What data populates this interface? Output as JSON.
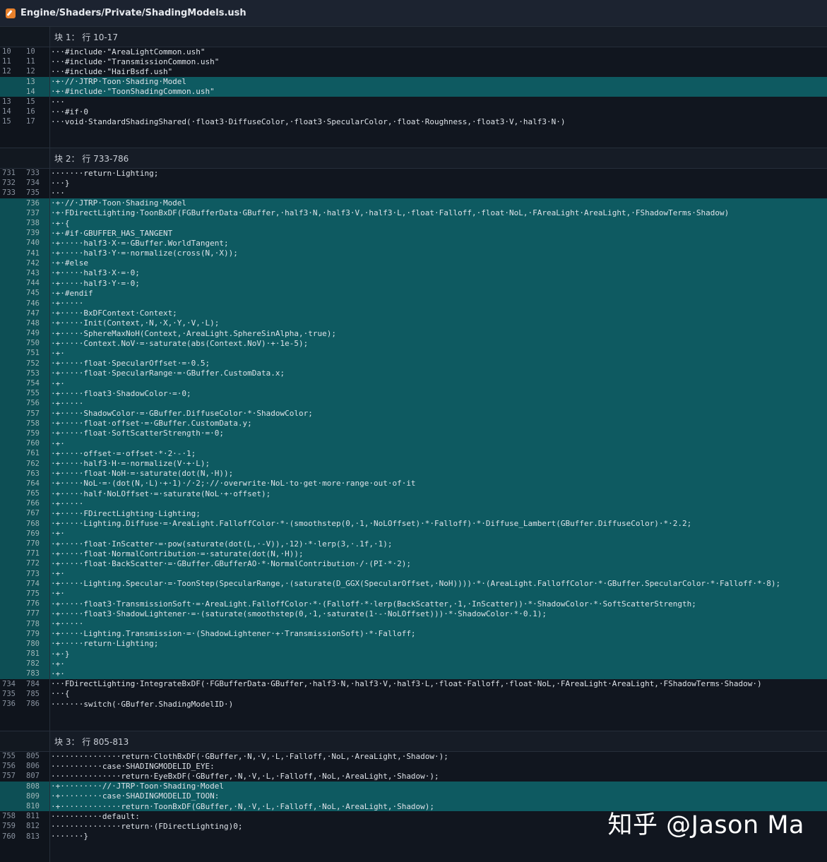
{
  "file": {
    "path": "Engine/Shaders/Private/ShadingModels.ush",
    "icon": "pencil-file-icon"
  },
  "hunks": [
    {
      "label": "块 1： 行 10-17",
      "lines": [
        {
          "o": "10",
          "n": "10",
          "t": "ctx",
          "c": "···#include·\"AreaLightCommon.ush\""
        },
        {
          "o": "11",
          "n": "11",
          "t": "ctx",
          "c": "···#include·\"TransmissionCommon.ush\""
        },
        {
          "o": "12",
          "n": "12",
          "t": "ctx",
          "c": "···#include·\"HairBsdf.ush\""
        },
        {
          "o": "",
          "n": "13",
          "t": "add",
          "c": "·+·//·JTRP·Toon·Shading·Model"
        },
        {
          "o": "",
          "n": "14",
          "t": "add",
          "c": "·+·#include·\"ToonShadingCommon.ush\""
        },
        {
          "o": "13",
          "n": "15",
          "t": "ctx",
          "c": "···"
        },
        {
          "o": "14",
          "n": "16",
          "t": "ctx",
          "c": "···#if·0"
        },
        {
          "o": "15",
          "n": "17",
          "t": "ctx",
          "c": "···void·StandardShadingShared(·float3·DiffuseColor,·float3·SpecularColor,·float·Roughness,·float3·V,·half3·N·)"
        }
      ]
    },
    {
      "label": "块 2： 行 733-786",
      "lines": [
        {
          "o": "731",
          "n": "733",
          "t": "ctx",
          "c": "·······return·Lighting;"
        },
        {
          "o": "732",
          "n": "734",
          "t": "ctx",
          "c": "···}"
        },
        {
          "o": "733",
          "n": "735",
          "t": "ctx",
          "c": "···"
        },
        {
          "o": "",
          "n": "736",
          "t": "add",
          "c": "·+·//·JTRP·Toon·Shading·Model"
        },
        {
          "o": "",
          "n": "737",
          "t": "add",
          "c": "·+·FDirectLighting·ToonBxDF(FGBufferData·GBuffer,·half3·N,·half3·V,·half3·L,·float·Falloff,·float·NoL,·FAreaLight·AreaLight,·FShadowTerms·Shadow)"
        },
        {
          "o": "",
          "n": "738",
          "t": "add",
          "c": "·+·{"
        },
        {
          "o": "",
          "n": "739",
          "t": "add",
          "c": "·+·#if·GBUFFER_HAS_TANGENT"
        },
        {
          "o": "",
          "n": "740",
          "t": "add",
          "c": "·+·····half3·X·=·GBuffer.WorldTangent;"
        },
        {
          "o": "",
          "n": "741",
          "t": "add",
          "c": "·+·····half3·Y·=·normalize(cross(N,·X));"
        },
        {
          "o": "",
          "n": "742",
          "t": "add",
          "c": "·+·#else"
        },
        {
          "o": "",
          "n": "743",
          "t": "add",
          "c": "·+·····half3·X·=·0;"
        },
        {
          "o": "",
          "n": "744",
          "t": "add",
          "c": "·+·····half3·Y·=·0;"
        },
        {
          "o": "",
          "n": "745",
          "t": "add",
          "c": "·+·#endif"
        },
        {
          "o": "",
          "n": "746",
          "t": "add",
          "c": "·+·····"
        },
        {
          "o": "",
          "n": "747",
          "t": "add",
          "c": "·+·····BxDFContext·Context;"
        },
        {
          "o": "",
          "n": "748",
          "t": "add",
          "c": "·+·····Init(Context,·N,·X,·Y,·V,·L);"
        },
        {
          "o": "",
          "n": "749",
          "t": "add",
          "c": "·+·····SphereMaxNoH(Context,·AreaLight.SphereSinAlpha,·true);"
        },
        {
          "o": "",
          "n": "750",
          "t": "add",
          "c": "·+·····Context.NoV·=·saturate(abs(Context.NoV)·+·1e-5);"
        },
        {
          "o": "",
          "n": "751",
          "t": "add",
          "c": "·+·"
        },
        {
          "o": "",
          "n": "752",
          "t": "add",
          "c": "·+·····float·SpecularOffset·=·0.5;"
        },
        {
          "o": "",
          "n": "753",
          "t": "add",
          "c": "·+·····float·SpecularRange·=·GBuffer.CustomData.x;"
        },
        {
          "o": "",
          "n": "754",
          "t": "add",
          "c": "·+·"
        },
        {
          "o": "",
          "n": "755",
          "t": "add",
          "c": "·+·····float3·ShadowColor·=·0;"
        },
        {
          "o": "",
          "n": "756",
          "t": "add",
          "c": "·+·····"
        },
        {
          "o": "",
          "n": "757",
          "t": "add",
          "c": "·+·····ShadowColor·=·GBuffer.DiffuseColor·*·ShadowColor;"
        },
        {
          "o": "",
          "n": "758",
          "t": "add",
          "c": "·+·····float·offset·=·GBuffer.CustomData.y;"
        },
        {
          "o": "",
          "n": "759",
          "t": "add",
          "c": "·+·····float·SoftScatterStrength·=·0;"
        },
        {
          "o": "",
          "n": "760",
          "t": "add",
          "c": "·+·"
        },
        {
          "o": "",
          "n": "761",
          "t": "add",
          "c": "·+·····offset·=·offset·*·2·-·1;"
        },
        {
          "o": "",
          "n": "762",
          "t": "add",
          "c": "·+·····half3·H·=·normalize(V·+·L);"
        },
        {
          "o": "",
          "n": "763",
          "t": "add",
          "c": "·+·····float·NoH·=·saturate(dot(N,·H));"
        },
        {
          "o": "",
          "n": "764",
          "t": "add",
          "c": "·+·····NoL·=·(dot(N,·L)·+·1)·/·2;·//·overwrite·NoL·to·get·more·range·out·of·it"
        },
        {
          "o": "",
          "n": "765",
          "t": "add",
          "c": "·+·····half·NoLOffset·=·saturate(NoL·+·offset);"
        },
        {
          "o": "",
          "n": "766",
          "t": "add",
          "c": "·+·····"
        },
        {
          "o": "",
          "n": "767",
          "t": "add",
          "c": "·+·····FDirectLighting·Lighting;"
        },
        {
          "o": "",
          "n": "768",
          "t": "add",
          "c": "·+·····Lighting.Diffuse·=·AreaLight.FalloffColor·*·(smoothstep(0,·1,·NoLOffset)·*·Falloff)·*·Diffuse_Lambert(GBuffer.DiffuseColor)·*·2.2;"
        },
        {
          "o": "",
          "n": "769",
          "t": "add",
          "c": "·+·"
        },
        {
          "o": "",
          "n": "770",
          "t": "add",
          "c": "·+·····float·InScatter·=·pow(saturate(dot(L,·-V)),·12)·*·lerp(3,·.1f,·1);"
        },
        {
          "o": "",
          "n": "771",
          "t": "add",
          "c": "·+·····float·NormalContribution·=·saturate(dot(N,·H));"
        },
        {
          "o": "",
          "n": "772",
          "t": "add",
          "c": "·+·····float·BackScatter·=·GBuffer.GBufferAO·*·NormalContribution·/·(PI·*·2);"
        },
        {
          "o": "",
          "n": "773",
          "t": "add",
          "c": "·+·"
        },
        {
          "o": "",
          "n": "774",
          "t": "add",
          "c": "·+·····Lighting.Specular·=·ToonStep(SpecularRange,·(saturate(D_GGX(SpecularOffset,·NoH))))·*·(AreaLight.FalloffColor·*·GBuffer.SpecularColor·*·Falloff·*·8);"
        },
        {
          "o": "",
          "n": "775",
          "t": "add",
          "c": "·+·"
        },
        {
          "o": "",
          "n": "776",
          "t": "add",
          "c": "·+·····float3·TransmissionSoft·=·AreaLight.FalloffColor·*·(Falloff·*·lerp(BackScatter,·1,·InScatter))·*·ShadowColor·*·SoftScatterStrength;"
        },
        {
          "o": "",
          "n": "777",
          "t": "add",
          "c": "·+·····float3·ShadowLightener·=·(saturate(smoothstep(0,·1,·saturate(1·-·NoLOffset)))·*·ShadowColor·*·0.1);"
        },
        {
          "o": "",
          "n": "778",
          "t": "add",
          "c": "·+·····"
        },
        {
          "o": "",
          "n": "779",
          "t": "add",
          "c": "·+·····Lighting.Transmission·=·(ShadowLightener·+·TransmissionSoft)·*·Falloff;"
        },
        {
          "o": "",
          "n": "780",
          "t": "add",
          "c": "·+·····return·Lighting;"
        },
        {
          "o": "",
          "n": "781",
          "t": "add",
          "c": "·+·}"
        },
        {
          "o": "",
          "n": "782",
          "t": "add",
          "c": "·+·"
        },
        {
          "o": "",
          "n": "783",
          "t": "add",
          "c": "·+·"
        },
        {
          "o": "734",
          "n": "784",
          "t": "ctx",
          "c": "···FDirectLighting·IntegrateBxDF(·FGBufferData·GBuffer,·half3·N,·half3·V,·half3·L,·float·Falloff,·float·NoL,·FAreaLight·AreaLight,·FShadowTerms·Shadow·)"
        },
        {
          "o": "735",
          "n": "785",
          "t": "ctx",
          "c": "···{"
        },
        {
          "o": "736",
          "n": "786",
          "t": "ctx",
          "c": "·······switch(·GBuffer.ShadingModelID·)"
        }
      ]
    },
    {
      "label": "块 3： 行 805-813",
      "lines": [
        {
          "o": "755",
          "n": "805",
          "t": "ctx",
          "c": "···············return·ClothBxDF(·GBuffer,·N,·V,·L,·Falloff,·NoL,·AreaLight,·Shadow·);"
        },
        {
          "o": "756",
          "n": "806",
          "t": "ctx",
          "c": "···········case·SHADINGMODELID_EYE:"
        },
        {
          "o": "757",
          "n": "807",
          "t": "ctx",
          "c": "···············return·EyeBxDF(·GBuffer,·N,·V,·L,·Falloff,·NoL,·AreaLight,·Shadow·);"
        },
        {
          "o": "",
          "n": "808",
          "t": "add",
          "c": "·+·········//·JTRP·Toon·Shading·Model"
        },
        {
          "o": "",
          "n": "809",
          "t": "add",
          "c": "·+·········case·SHADINGMODELID_TOON:"
        },
        {
          "o": "",
          "n": "810",
          "t": "add",
          "c": "·+·············return·ToonBxDF(GBuffer,·N,·V,·L,·Falloff,·NoL,·AreaLight,·Shadow);"
        },
        {
          "o": "758",
          "n": "811",
          "t": "ctx",
          "c": "···········default:"
        },
        {
          "o": "759",
          "n": "812",
          "t": "ctx",
          "c": "···············return·(FDirectLighting)0;"
        },
        {
          "o": "760",
          "n": "813",
          "t": "ctx",
          "c": "·······}"
        }
      ]
    }
  ],
  "watermark": "知乎 @Jason Ma",
  "colors": {
    "background": "#11161f",
    "added_line": "#0e5a61",
    "titlebar": "#1c2330",
    "icon": "#e8812c"
  }
}
